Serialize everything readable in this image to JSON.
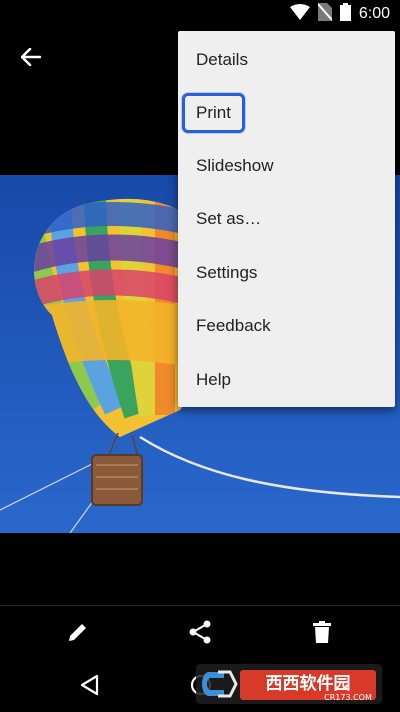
{
  "status_bar": {
    "time": "6:00",
    "icons": [
      "wifi-icon",
      "no-sim-icon",
      "battery-icon"
    ]
  },
  "app_bar": {
    "back_icon": "arrow-back-icon"
  },
  "overflow_menu": {
    "items": [
      {
        "label": "Details"
      },
      {
        "label": "Print",
        "focused": true
      },
      {
        "label": "Slideshow"
      },
      {
        "label": "Set as…"
      },
      {
        "label": "Settings"
      },
      {
        "label": "Feedback"
      },
      {
        "label": "Help"
      }
    ]
  },
  "action_bar": {
    "icons": [
      "edit-icon",
      "share-icon",
      "delete-icon"
    ]
  },
  "nav_bar": {
    "icons": [
      "nav-back-icon",
      "nav-home-icon"
    ]
  },
  "watermark": {
    "text": "西西软件园",
    "subtext": "CR173.COM"
  },
  "colors": {
    "menu_background": "#efefef",
    "focus_ring": "#2a5fd6",
    "sky": "#1a4fb0"
  }
}
